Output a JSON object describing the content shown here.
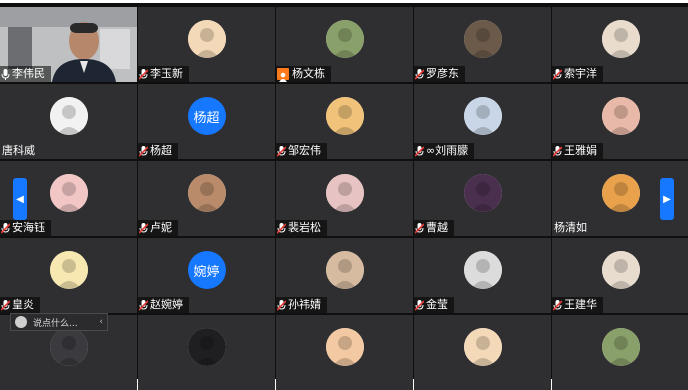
{
  "participants": [
    {
      "name": "李伟民",
      "type": "video",
      "icon": "mic-icon"
    },
    {
      "name": "李玉新",
      "type": "avatar",
      "icon": "mic-muted-icon",
      "avatar": "cartoon-avatar-icon"
    },
    {
      "name": "杨文栋",
      "type": "avatar",
      "icon": "host-icon",
      "avatar": "landscape-avatar-icon"
    },
    {
      "name": "罗彦东",
      "type": "avatar",
      "icon": "mic-muted-icon",
      "avatar": "drinks-avatar-icon"
    },
    {
      "name": "索宇洋",
      "type": "avatar",
      "icon": "mic-muted-icon",
      "avatar": "cat-avatar-icon"
    },
    {
      "name": "唐科威",
      "type": "avatar",
      "icon": "",
      "avatar": "sketch-avatar-icon"
    },
    {
      "name": "杨超",
      "type": "text-avatar",
      "icon": "mic-muted-icon",
      "avatar_text": "杨超"
    },
    {
      "name": "邹宏伟",
      "type": "avatar",
      "icon": "mic-muted-icon",
      "avatar": "girl-avatar-icon"
    },
    {
      "name": "∞刘雨朦",
      "type": "avatar",
      "icon": "mic-muted-icon",
      "avatar": "doll-avatar-icon"
    },
    {
      "name": "王雅娟",
      "type": "avatar",
      "icon": "mic-muted-icon",
      "avatar": "kitten-avatar-icon"
    },
    {
      "name": "安海钰",
      "type": "avatar",
      "icon": "mic-muted-icon",
      "avatar": "pig-avatar-icon"
    },
    {
      "name": "卢妮",
      "type": "avatar",
      "icon": "mic-muted-icon",
      "avatar": "portrait-avatar-icon"
    },
    {
      "name": "裴岩松",
      "type": "avatar",
      "icon": "mic-muted-icon",
      "avatar": "piglet-avatar-icon"
    },
    {
      "name": "曹越",
      "type": "avatar",
      "icon": "mic-muted-icon",
      "avatar": "city-avatar-icon"
    },
    {
      "name": "杨清如",
      "type": "avatar",
      "icon": "",
      "avatar": "anime-avatar-icon"
    },
    {
      "name": "皇炎",
      "type": "avatar",
      "icon": "mic-muted-icon",
      "avatar": "drawing-avatar-icon"
    },
    {
      "name": "赵婉婷",
      "type": "text-avatar",
      "icon": "mic-muted-icon",
      "avatar_text": "婉婷"
    },
    {
      "name": "孙祎婧",
      "type": "avatar",
      "icon": "mic-muted-icon",
      "avatar": "cat-face-avatar-icon"
    },
    {
      "name": "金莹",
      "type": "avatar",
      "icon": "mic-muted-icon",
      "avatar": "sailor-avatar-icon"
    },
    {
      "name": "王建华",
      "type": "avatar",
      "icon": "mic-muted-icon",
      "avatar": "anime-boy-avatar-icon"
    },
    {
      "name": "",
      "type": "avatar",
      "icon": "",
      "avatar": "person-avatar-icon"
    },
    {
      "name": "",
      "type": "avatar",
      "icon": "",
      "avatar": "dog-avatar-icon"
    },
    {
      "name": "",
      "type": "avatar",
      "icon": "",
      "avatar": "man-avatar-icon"
    },
    {
      "name": "",
      "type": "avatar",
      "icon": "",
      "avatar": "woman-avatar-icon"
    },
    {
      "name": "",
      "type": "avatar",
      "icon": "",
      "avatar": "illustrated-girl-avatar-icon"
    }
  ],
  "chat": {
    "placeholder": "说点什么..."
  },
  "colors": {
    "accent": "#1677ff",
    "host": "#ff7a1a",
    "tile_bg": "#2f2f31"
  }
}
